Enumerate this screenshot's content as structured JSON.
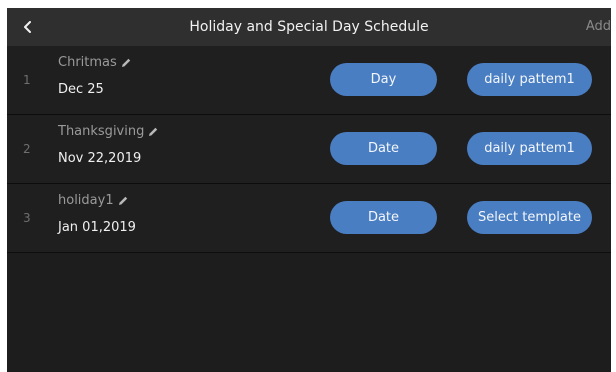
{
  "header": {
    "title": "Holiday and Special Day Schedule",
    "add_label": "Add",
    "back_icon": "chevron-left-icon"
  },
  "rows": [
    {
      "index": "1",
      "name": "Chritmas",
      "date": "Dec 25",
      "type": "Day",
      "template": "daily pattem1"
    },
    {
      "index": "2",
      "name": "Thanksgiving",
      "date": "Nov 22,2019",
      "type": "Date",
      "template": "daily pattem1"
    },
    {
      "index": "3",
      "name": "holiday1",
      "date": "Jan 01,2019",
      "type": "Date",
      "template": "Select template"
    }
  ],
  "colors": {
    "background": "#1d1d1d",
    "header": "#2f2f2f",
    "accent": "#4a7ec3"
  }
}
